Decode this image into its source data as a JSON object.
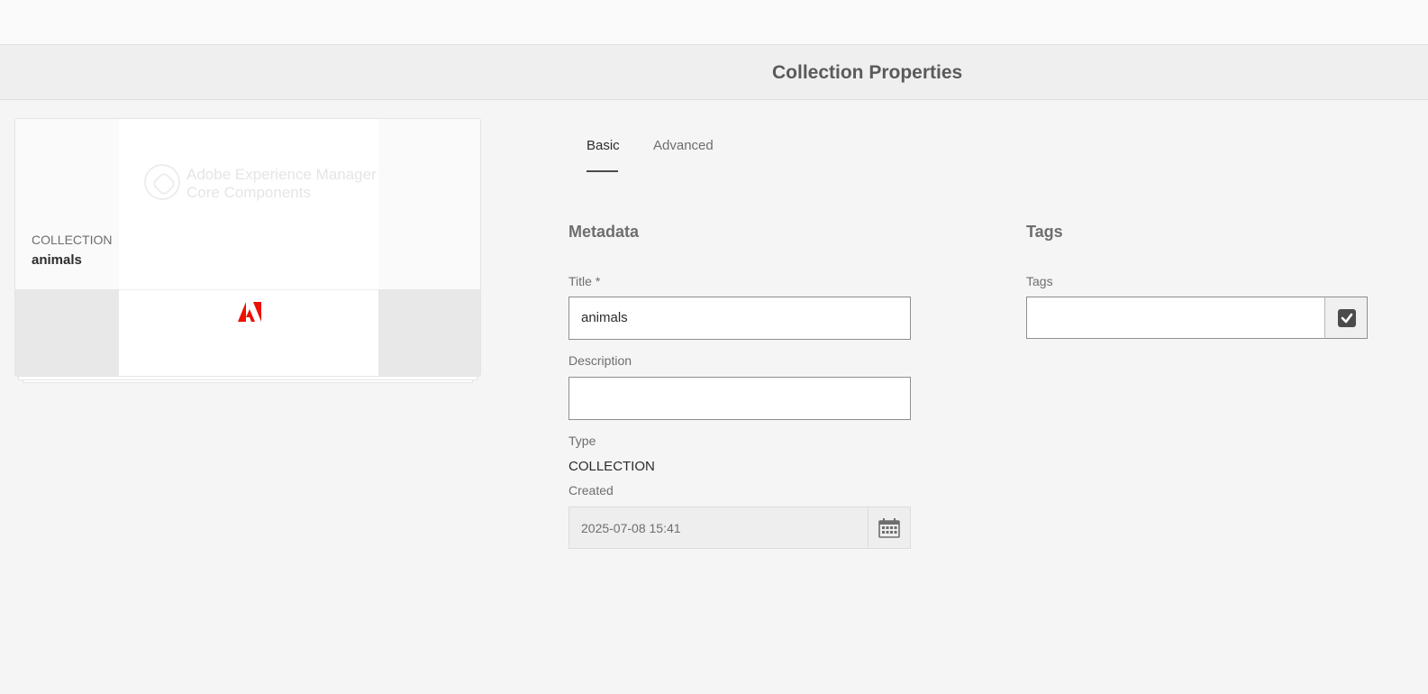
{
  "header": {
    "title": "Collection Properties"
  },
  "card": {
    "type_label": "COLLECTION",
    "name": "animals",
    "thumbnail_logo_line1": "Adobe Experience Manager",
    "thumbnail_logo_line2": "Core Components",
    "adobe_mark_icon": "adobe-logo-icon"
  },
  "tabs": [
    {
      "label": "Basic",
      "active": true
    },
    {
      "label": "Advanced",
      "active": false
    }
  ],
  "metadata": {
    "heading": "Metadata",
    "title_label": "Title *",
    "title_value": "animals",
    "description_label": "Description",
    "description_value": "",
    "type_label": "Type",
    "type_value": "COLLECTION",
    "created_label": "Created",
    "created_value": "2025-07-08 15:41",
    "calendar_icon": "calendar-icon"
  },
  "tags": {
    "heading": "Tags",
    "field_label": "Tags",
    "field_value": "",
    "picker_icon": "checkbox-checked-icon"
  },
  "colors": {
    "background": "#f5f5f5",
    "adobe_red": "#eb1000",
    "text_dark": "#2c2c2c",
    "text_muted": "#6e6e6e"
  }
}
